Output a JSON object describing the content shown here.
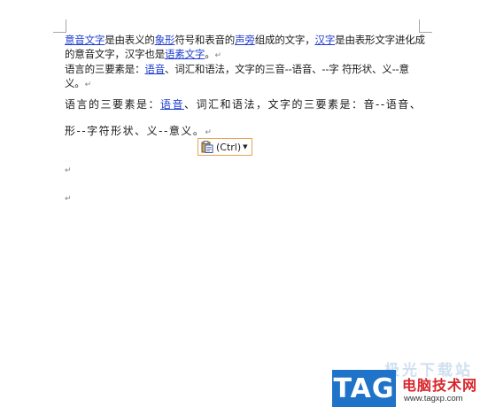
{
  "paragraph1": {
    "seg1": "意音文字",
    "seg2": "是由表义的",
    "seg3": "象形",
    "seg4": "符号和表音的",
    "seg5": "声旁",
    "seg6": "组成的文字，",
    "seg7": "汉字",
    "seg8": "是由表形文字进化成的意音文字，汉字也是",
    "seg9": "语素文字",
    "end": "。"
  },
  "paragraph2": {
    "seg1": "语言的三要素是：",
    "seg2": "语音",
    "seg3": "、词汇和语法，文字的三音--语音、--字 符形状、义--意义。"
  },
  "paragraph3": {
    "seg1": "语言的三要素是：",
    "seg2": "语音",
    "seg3": "、词汇和语法，文字的三要素是：音--语音、形--字符形状、义--意义。"
  },
  "paste_options": {
    "label": "(Ctrl)",
    "icon": "clipboard-paste-icon"
  },
  "paragraph_mark": "↵",
  "watermark": {
    "tag": "TAG",
    "title": "电脑技术网",
    "url": "www.tagxp.com",
    "faded_text": "极光下载站"
  },
  "colors": {
    "link": "#1f3fd0",
    "paste_border": "#e6a355",
    "tag_blue": "#1f73c8",
    "title_red": "#d8262b"
  }
}
